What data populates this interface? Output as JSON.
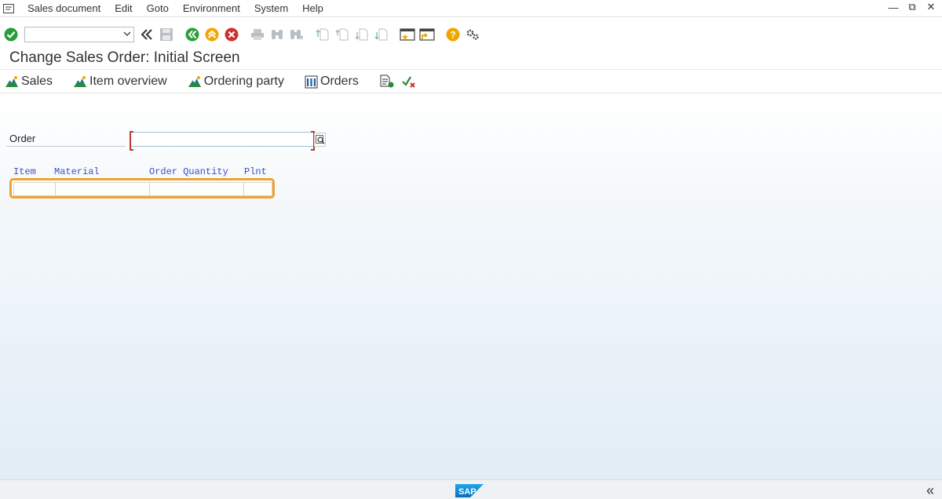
{
  "menubar": {
    "items": [
      "Sales document",
      "Edit",
      "Goto",
      "Environment",
      "System",
      "Help"
    ]
  },
  "window": {
    "minimize": "—",
    "restore": "⧉",
    "close": "✕"
  },
  "toolbar": {
    "command_field_value": "",
    "icons": [
      "enter-icon",
      "command-dropdown-icon",
      "collapse-double-left-icon",
      "save-icon",
      "back-icon",
      "exit-icon",
      "cancel-icon",
      "print-icon",
      "find-icon",
      "find-next-icon",
      "first-page-icon",
      "previous-page-icon",
      "next-page-icon",
      "last-page-icon",
      "create-session-icon",
      "shortcut-icon",
      "help-icon",
      "customize-layout-icon"
    ]
  },
  "title": "Change Sales Order: Initial Screen",
  "apptoolbar": {
    "sales": "Sales",
    "item_overview": "Item overview",
    "ordering_party": "Ordering party",
    "orders": "Orders"
  },
  "form": {
    "order_label": "Order",
    "order_value": ""
  },
  "table": {
    "columns": [
      "Item",
      "Material",
      "Order Quantity",
      "Plnt"
    ],
    "rows": [
      [
        "",
        "",
        "",
        ""
      ]
    ]
  },
  "statusbar": {
    "logo_text": "SAP"
  },
  "colors": {
    "highlight": "#f0a22f",
    "column_header": "#3a4fc4",
    "enter_green": "#2a9d3a",
    "cancel_red": "#d0312d",
    "exit_orange": "#f0a500"
  }
}
